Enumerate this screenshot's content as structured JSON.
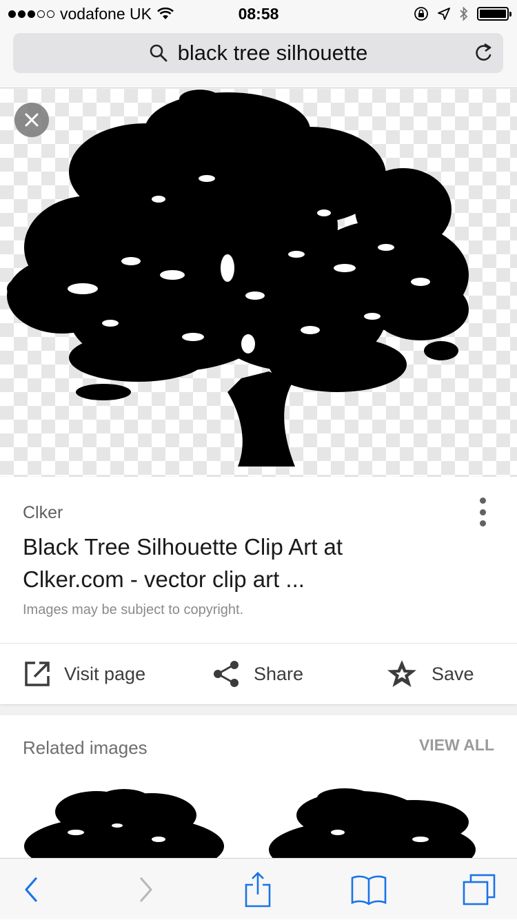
{
  "status_bar": {
    "carrier": "vodafone UK",
    "time": "08:58",
    "signal_bars_filled": 3,
    "signal_bars_total": 5,
    "battery_level": 1.0
  },
  "address_bar": {
    "query": "black tree silhouette"
  },
  "result": {
    "source": "Clker",
    "title": "Black Tree Silhouette Clip Art at Clker.com - vector clip art ...",
    "copyright": "Images may be subject to copyright."
  },
  "actions": {
    "visit": "Visit page",
    "share": "Share",
    "save": "Save"
  },
  "related": {
    "title": "Related images",
    "view_all": "VIEW ALL"
  },
  "colors": {
    "ios_blue": "#1a73e8",
    "disabled": "#b8b8b8"
  }
}
